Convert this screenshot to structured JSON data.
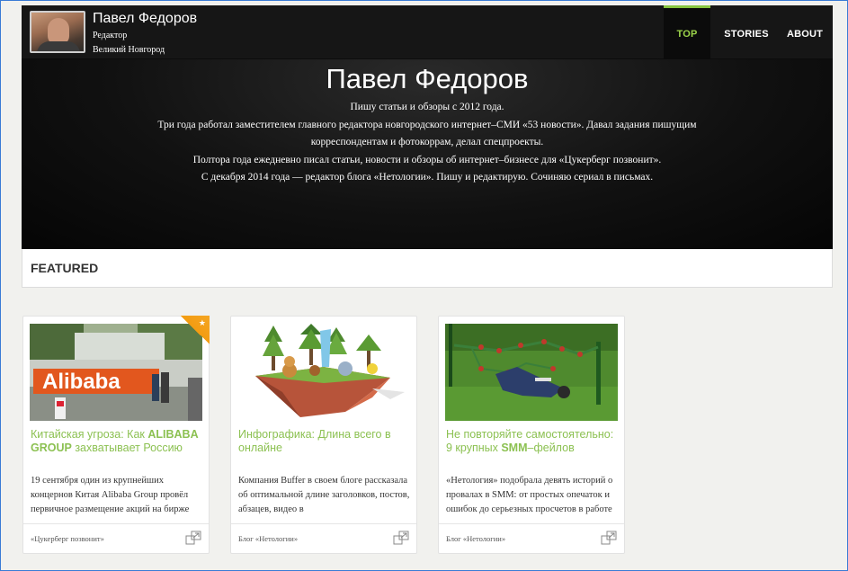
{
  "header": {
    "name": "Павел Федоров",
    "role": "Редактор",
    "city": "Великий Новгород"
  },
  "nav": {
    "top": "TOP",
    "stories": "STORIES",
    "about": "ABOUT",
    "active": "top",
    "accent_color": "#9bd34a"
  },
  "hero": {
    "title": "Павел Федоров",
    "bio": [
      "Пишу статьи и обзоры с 2012 года.",
      "Три года работал заместителем главного редактора новгородского интернет–СМИ «53 новости». Давал задания пишущим корреспондентам и фотокоррам, делал спецпроекты.",
      "Полтора года ежедневно писал статьи, новости и обзоры об интернет–бизнесе для «Цукерберг позвонит».",
      "С декабря 2014 года — редактор блога «Нетологии». Пишу и редактирую. Сочиняю сериал в письмах."
    ]
  },
  "featured": {
    "title": "FEATURED"
  },
  "cards": [
    {
      "title_pre": "Китайская угроза: Как ",
      "title_bold": "ALIBABA GROUP",
      "title_post": " захватывает Россию",
      "excerpt": "19 сентября один из крупнейших концернов Китая Alibaba Group провёл первичное размещение акций на бирже",
      "source": "«Цукерберг позвонит»",
      "image": "alibaba-office-photo",
      "featured_badge": true
    },
    {
      "title_pre": "Инфографика: Длина всего в онлайне",
      "title_bold": "",
      "title_post": "",
      "excerpt": "Компания Buffer в своем блоге рассказала об оптимальной длине заголовков, постов, абзацев, видео в",
      "source": "Блог «Нетологии»",
      "image": "lowpoly-island-illustration",
      "featured_badge": false
    },
    {
      "title_pre": "Не повторяйте самостоятельно: 9 крупных ",
      "title_bold": "SMM",
      "title_post": "–фейлов",
      "excerpt": "«Нетология» подобрала девять историй о провалах в SMM: от простых опечаток и ошибок до серьезных просчетов в работе",
      "source": "Блог «Нетологии»",
      "image": "playground-fail-photo",
      "featured_badge": false
    }
  ]
}
